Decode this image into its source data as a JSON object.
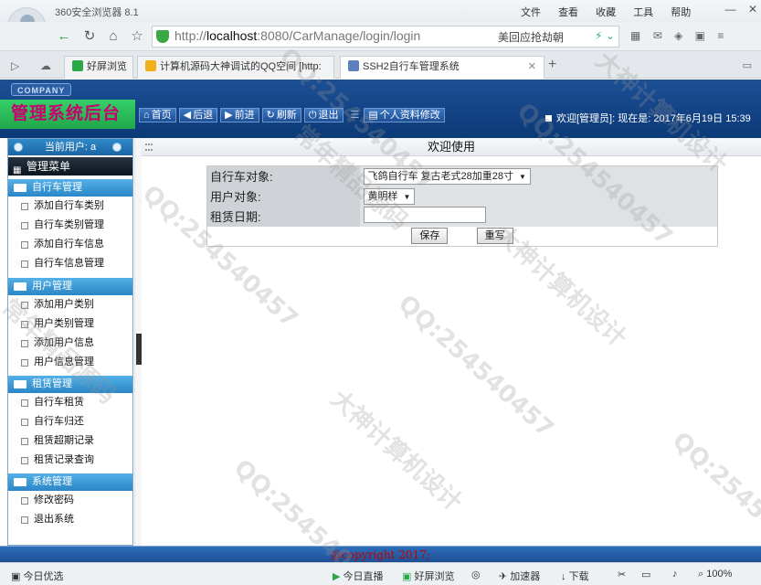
{
  "browser": {
    "app_title": "360安全浏览器 8.1",
    "menus": [
      "文件",
      "查看",
      "收藏",
      "工具",
      "帮助"
    ],
    "url_gray_prefix": "http://",
    "url_host": "localhost",
    "url_rest": ":8080/CarManage/login/login",
    "search_hint": "美回应抢劫朝",
    "tabs": [
      {
        "label": "好屏浏览",
        "icon_color": "#2aa845"
      },
      {
        "label": "计算机源码大神调试的QQ空间 [http:",
        "icon_color": "#f2b01e"
      },
      {
        "label": "SSH2自行车管理系统",
        "icon_color": "#5b7fbf"
      }
    ]
  },
  "header": {
    "company": "COMPANY",
    "title": "管理系统后台",
    "nav": [
      {
        "icon": "⌂",
        "label": "首页"
      },
      {
        "icon": "◀",
        "label": "后退"
      },
      {
        "icon": "▶",
        "label": "前进"
      },
      {
        "icon": "↻",
        "label": "刷新"
      },
      {
        "icon": "⏻",
        "label": "退出"
      }
    ],
    "profile_button": "个人资料修改",
    "welcome": "欢迎[管理员]:  现在是: 2017年6月19日 15:39"
  },
  "sidebar": {
    "current_user": "当前用户: a",
    "menu_title": "管理菜单",
    "groups": [
      {
        "title": "自行车管理",
        "items": [
          "添加自行车类别",
          "自行车类别管理",
          "添加自行车信息",
          "自行车信息管理"
        ]
      },
      {
        "title": "用户管理",
        "items": [
          "添加用户类别",
          "用户类别管理",
          "添加用户信息",
          "用户信息管理"
        ]
      },
      {
        "title": "租赁管理",
        "items": [
          "自行车租赁",
          "自行车归还",
          "租赁超期记录",
          "租赁记录查询"
        ]
      },
      {
        "title": "系统管理",
        "items": [
          "修改密码",
          "退出系统"
        ]
      }
    ]
  },
  "content": {
    "title": "欢迎使用",
    "fields": [
      {
        "label": "自行车对象:",
        "value": "飞鸽自行车 复古老式28加重28寸"
      },
      {
        "label": "用户对象:",
        "value": "黄明样"
      },
      {
        "label": "租赁日期:",
        "value": ""
      }
    ],
    "save_label": "保存",
    "reset_label": "重写"
  },
  "footer": {
    "copyright": "@copyright 2017;"
  },
  "statusbar": {
    "left": "今日优选",
    "live": "今日直播",
    "screen": "好屏浏览",
    "accelerator": "加速器",
    "download": "下载",
    "zoom": "100%"
  },
  "watermark": {
    "qq": "QQ:254540457",
    "shop": "大神计算机设计",
    "code": "常年精品源码"
  }
}
